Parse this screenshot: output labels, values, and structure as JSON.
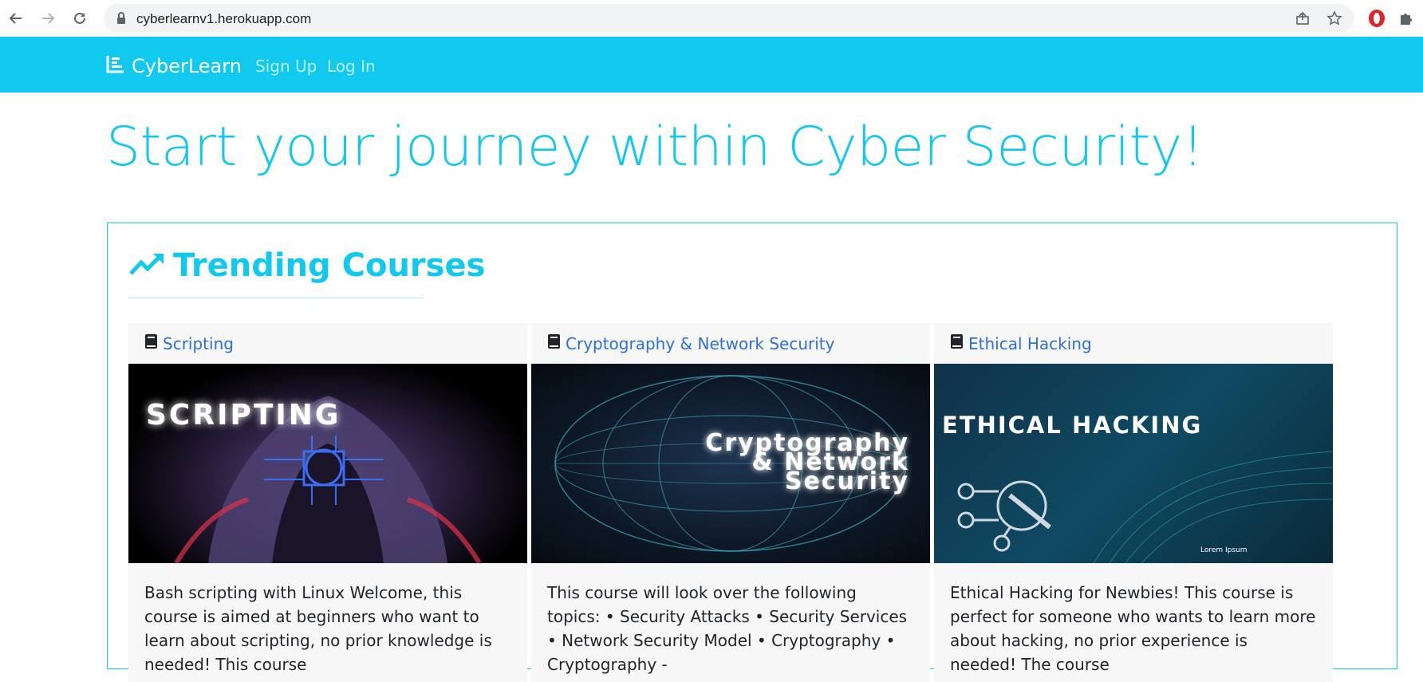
{
  "browser": {
    "url": "cyberlearnv1.herokuapp.com"
  },
  "navbar": {
    "brand": "CyberLearn",
    "links": [
      "Sign Up",
      "Log In"
    ],
    "color": "#11c9ef"
  },
  "hero": {
    "title": "Start your journey within Cyber Security!"
  },
  "trending": {
    "title": "Trending Courses",
    "icon": "trending-up-icon",
    "courses": [
      {
        "title": "Scripting",
        "image_text": "SCRIPTING",
        "description": "Bash scripting with Linux Welcome, this course is aimed at beginners who want to learn about scripting, no prior knowledge is needed! This course"
      },
      {
        "title": "Cryptography & Network Security",
        "image_text_lines": [
          "Cryptography",
          "& Network",
          "Security"
        ],
        "description": "This course will look over the following topics: • Security Attacks • Security Services • Network Security Model • Cryptography • Cryptography -"
      },
      {
        "title": "Ethical Hacking",
        "image_text": "ETHICAL HACKING",
        "image_caption": "Lorem Ipsum",
        "description": "Ethical Hacking for Newbies! This course is perfect for someone who wants to learn more about hacking, no prior experience is needed! The course"
      }
    ]
  }
}
